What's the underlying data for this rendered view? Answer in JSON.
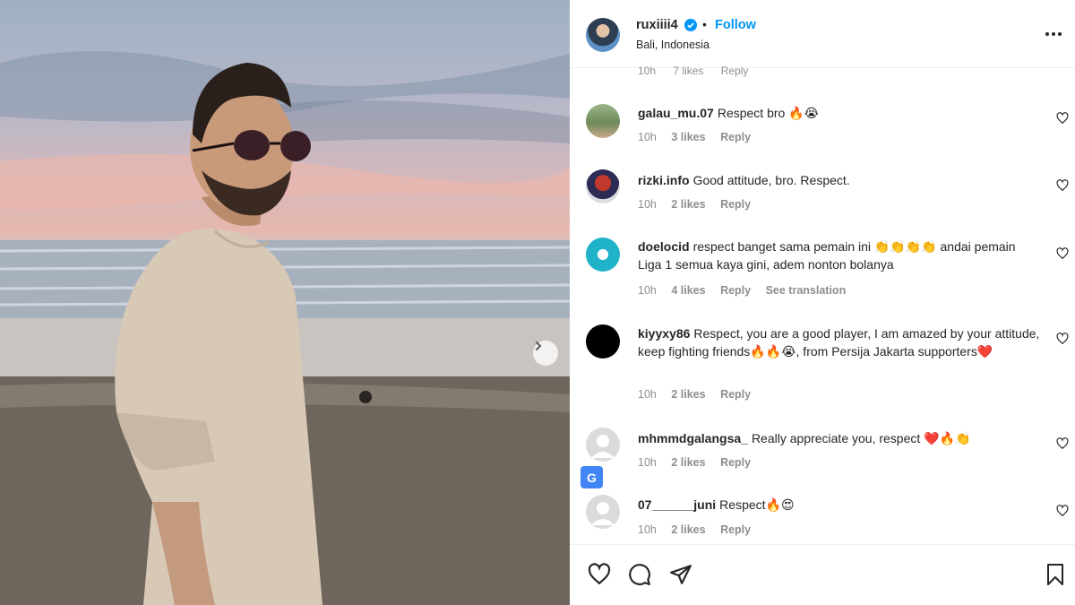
{
  "post": {
    "username": "ruxiiii4",
    "follow_label": "Follow",
    "separator": "•",
    "location": "Bali, Indonesia"
  },
  "peek_meta": [
    "10h",
    "7 likes",
    "Reply"
  ],
  "comments": [
    {
      "user": "galau_mu.07",
      "text": "Respect bro 🔥😭",
      "time": "10h",
      "likes": "3 likes",
      "reply": "Reply",
      "avatar": "photo-outdoor"
    },
    {
      "user": "rizki.info",
      "text": "Good attitude, bro. Respect.",
      "time": "10h",
      "likes": "2 likes",
      "reply": "Reply",
      "avatar": "photo-person-red"
    },
    {
      "user": "doelocid",
      "text": "respect banget sama pemain ini 👏👏👏👏 andai pemain Liga 1 semua kaya gini, adem nonton bolanya",
      "time": "10h",
      "likes": "4 likes",
      "reply": "Reply",
      "see_translation": "See translation",
      "avatar": "cyan-logo"
    },
    {
      "user": "kiyyxy86",
      "text": "Respect, you are a good player, I am amazed by your attitude, keep fighting friends🔥🔥😭, from Persija Jakarta supporters❤️",
      "time": "10h",
      "likes": "2 likes",
      "reply": "Reply",
      "avatar": "black-circle"
    },
    {
      "user": "mhmmdgalangsa_",
      "text": "Really appreciate you, respect ❤️🔥👏",
      "time": "10h",
      "likes": "2 likes",
      "reply": "Reply",
      "avatar": "default-avatar"
    },
    {
      "user": "07______juni",
      "text": "Respect🔥😍",
      "time": "10h",
      "likes": "2 likes",
      "reply": "Reply",
      "avatar": "default-avatar"
    }
  ],
  "translate_badge": "G",
  "colors": {
    "link": "#0095f6",
    "verified": "#0095f6",
    "meta": "#8e8e8e",
    "text": "#262626"
  },
  "icons": [
    "verified-badge-icon",
    "more-options-icon",
    "heart-icon",
    "comment-icon",
    "share-icon",
    "bookmark-icon",
    "chevron-right-icon"
  ]
}
